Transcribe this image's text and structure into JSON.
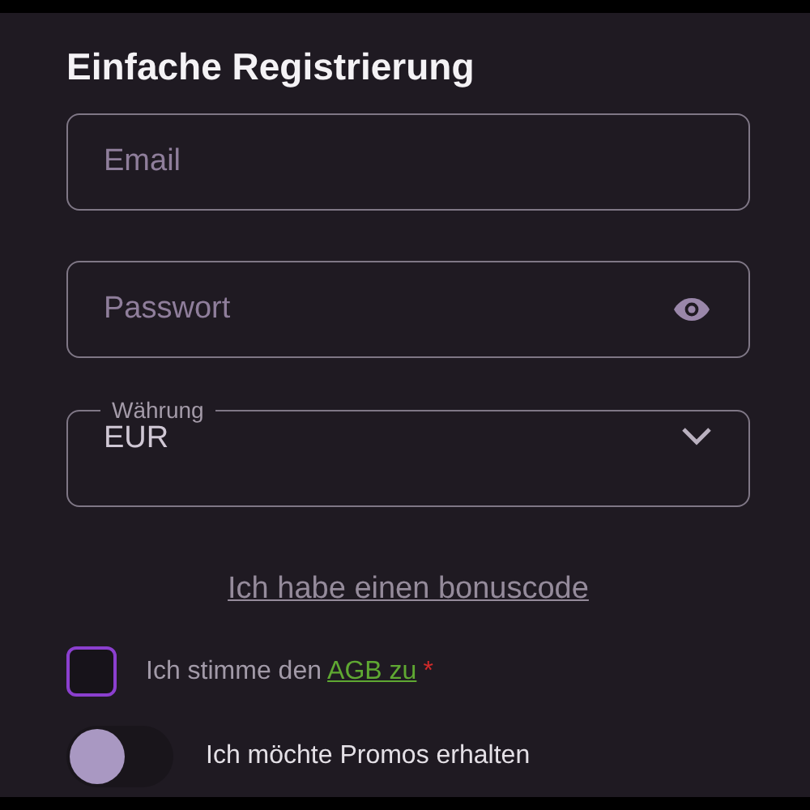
{
  "title": "Einfache Registrierung",
  "fields": [
    {
      "kind": "text",
      "placeholder": "Email"
    },
    {
      "kind": "password",
      "placeholder": "Passwort"
    },
    {
      "kind": "select",
      "label": "Währung",
      "value": "EUR"
    }
  ],
  "bonus_link": "Ich habe einen bonuscode",
  "consent": {
    "checked": false,
    "text": "Ich stimme den ",
    "link": "AGB zu",
    "required_mark": "*"
  },
  "promos": {
    "on": false,
    "label": "Ich möchte Promos erhalten"
  }
}
